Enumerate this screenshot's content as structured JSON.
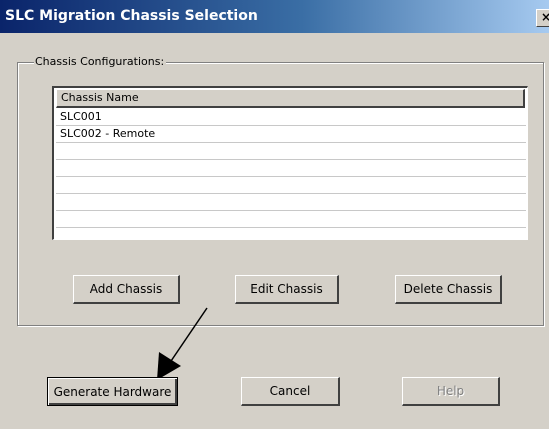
{
  "window": {
    "title": "SLC Migration Chassis Selection",
    "close_label": "×"
  },
  "group": {
    "label": "Chassis Configurations:"
  },
  "list": {
    "header": "Chassis Name",
    "rows": [
      "SLC001",
      "SLC002 - Remote",
      "",
      "",
      "",
      "",
      "",
      "",
      ""
    ]
  },
  "chassis_buttons": {
    "add": "Add Chassis",
    "edit": "Edit Chassis",
    "delete": "Delete Chassis"
  },
  "dialog_buttons": {
    "generate": "Generate Hardware",
    "cancel": "Cancel",
    "help": "Help",
    "help_disabled": true
  },
  "colors": {
    "title_gradient_start": "#0a246a",
    "title_gradient_end": "#a6caf0",
    "face": "#d4d0c8"
  }
}
